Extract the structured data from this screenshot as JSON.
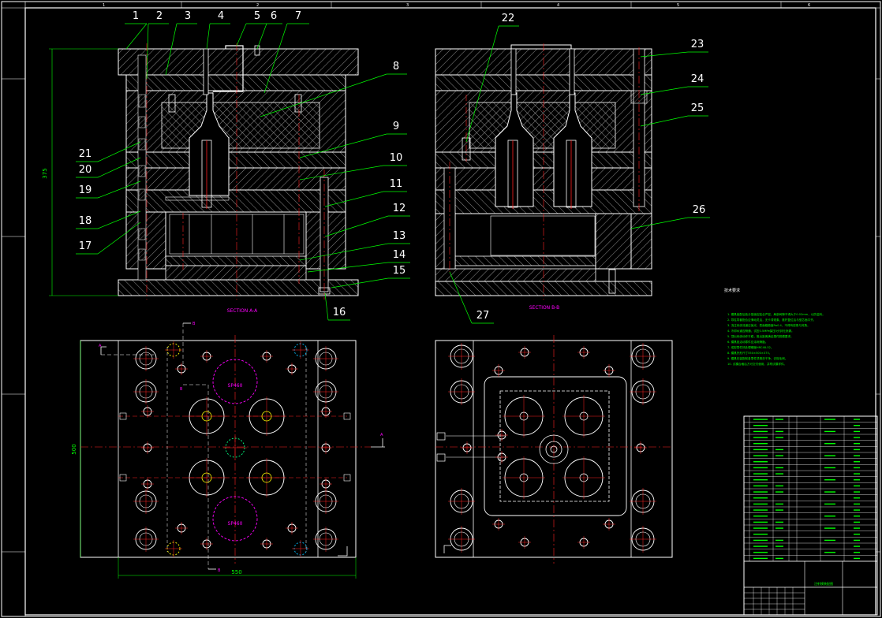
{
  "colors": {
    "background": "#000000",
    "outline": "#ffffff",
    "hatch": "#c8c8c8",
    "centerline": "#ff2020",
    "label": "#ffffff",
    "leader": "#00ff00",
    "dimension": "#00ff00",
    "section_text": "#ff00ff",
    "notes_text": "#00ff00",
    "gate_symbol": "#ff00ff"
  },
  "zone_numbers": [
    "1",
    "2",
    "3",
    "4",
    "5",
    "6"
  ],
  "section_views": {
    "left_title": "SECTION A-A",
    "right_title": "SECTION B-B"
  },
  "part_labels": {
    "left": [
      "1",
      "2",
      "3",
      "4",
      "5",
      "6",
      "7",
      "8",
      "9",
      "10",
      "11",
      "12",
      "13",
      "14",
      "15",
      "16",
      "17",
      "18",
      "19",
      "20",
      "21"
    ],
    "right": [
      "22",
      "23",
      "24",
      "25",
      "26",
      "27"
    ]
  },
  "dimensions": {
    "overall_height": "375",
    "plan_height": "500",
    "plan_width": "550"
  },
  "plan_view": {
    "cut_marks": [
      "A",
      "A",
      "B",
      "B",
      "B"
    ],
    "gate_labels": [
      "SP460",
      "SP460"
    ]
  },
  "notes": {
    "title": "技术要求",
    "lines": [
      "1. 模具装配后各分型面应贴合严密，局部间隙不得大于0.02mm，以防溢料。",
      "2. 导柱导套配合应滑动灵活，无卡滞现象，推杆复位后与型芯面平齐。",
      "3. 浇注系统流道应抛光，表面粗糙度Ra0.4，不得有锐角与死角。",
      "4. 冷却水道应畅通，试压0.5MPa保压5分钟无渗漏。",
      "5. 顶出系统动作平稳，推出距离满足塑件脱模要求。",
      "6. 模具各活动零件应涂润滑脂。",
      "7. 成型零件热处理硬度HRC48-52。",
      "8. 模具外形尺寸550×500×375。",
      "9. 模具在装配前各零件须清洗干净，去除毛刺。",
      "10. 试模合格后方可交付使用，并附试模样件。"
    ]
  },
  "title_block": {
    "rows": 24,
    "drawing_name": "注射模装配图"
  }
}
